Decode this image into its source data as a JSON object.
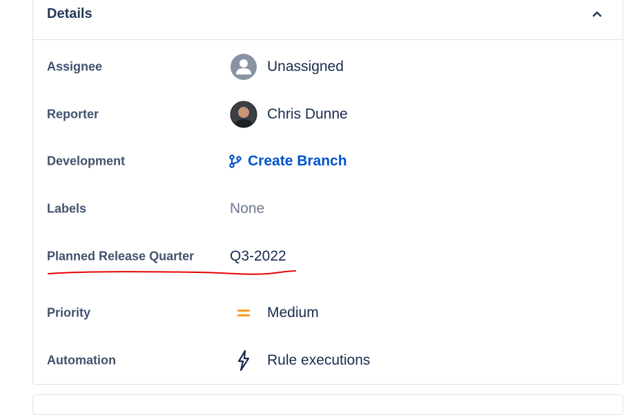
{
  "details": {
    "title": "Details",
    "collapse_icon": "chevron-up-icon",
    "assignee": {
      "label": "Assignee",
      "value": "Unassigned",
      "icon": "default-avatar-icon"
    },
    "reporter": {
      "label": "Reporter",
      "value": "Chris Dunne",
      "icon": "user-avatar"
    },
    "development": {
      "label": "Development",
      "link_text": "Create Branch",
      "icon": "branch-icon",
      "link_color": "#0052cc"
    },
    "labels": {
      "label": "Labels",
      "value": "None"
    },
    "planned_release_quarter": {
      "label": "Planned Release Quarter",
      "value": "Q3-2022",
      "annotation": "red-underline",
      "annotation_color": "#e60000"
    },
    "priority": {
      "label": "Priority",
      "value": "Medium",
      "icon": "priority-medium-icon",
      "icon_color": "#ff991f"
    },
    "automation": {
      "label": "Automation",
      "value": "Rule executions",
      "icon": "lightning-icon"
    }
  }
}
